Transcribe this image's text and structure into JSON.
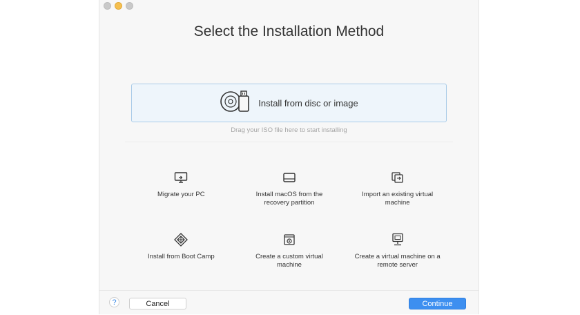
{
  "window": {
    "title": "Select the Installation Method"
  },
  "drop_zone": {
    "label": "Install from disc or image",
    "icon": "disc-usb-icon",
    "hint": "Drag your ISO file here to start installing"
  },
  "options": [
    {
      "label": "Migrate your PC",
      "icon": "pc-migrate-icon"
    },
    {
      "label": "Install macOS from the recovery partition",
      "icon": "drive-icon"
    },
    {
      "label": "Import an existing virtual machine",
      "icon": "import-vm-icon"
    },
    {
      "label": "Install from Boot Camp",
      "icon": "bootcamp-icon"
    },
    {
      "label": "Create a custom virtual machine",
      "icon": "custom-vm-icon"
    },
    {
      "label": "Create a virtual machine on a remote server",
      "icon": "remote-server-icon"
    }
  ],
  "footer": {
    "help": "?",
    "cancel_label": "Cancel",
    "continue_label": "Continue"
  },
  "colors": {
    "accent": "#3d8ff0",
    "drop_zone_bg": "#eef5fb",
    "drop_zone_border": "#a9cbe8"
  }
}
